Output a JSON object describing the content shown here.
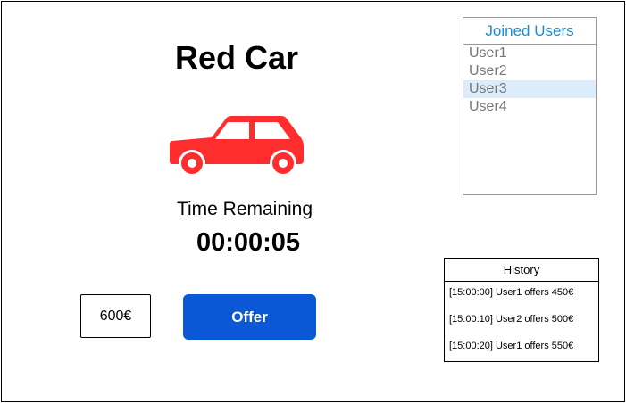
{
  "auction": {
    "title": "Red Car",
    "time_label": "Time Remaining",
    "time_value": "00:00:05"
  },
  "icons": {
    "car": "car-icon"
  },
  "colors": {
    "car": "#ff2d2d",
    "offer_button": "#0a58d6",
    "users_header": "#1a8cd8",
    "selected_user_bg": "#dcecfb"
  },
  "offer": {
    "input_value": "600€",
    "button_label": "Offer"
  },
  "joined_users": {
    "header": "Joined Users",
    "items": [
      "User1",
      "User2",
      "User3",
      "User4"
    ],
    "selected": "User3"
  },
  "history": {
    "header": "History",
    "entries": [
      "[15:00:00] User1 offers 450€",
      "[15:00:10] User2 offers 500€",
      "[15:00:20] User1 offers 550€"
    ]
  }
}
